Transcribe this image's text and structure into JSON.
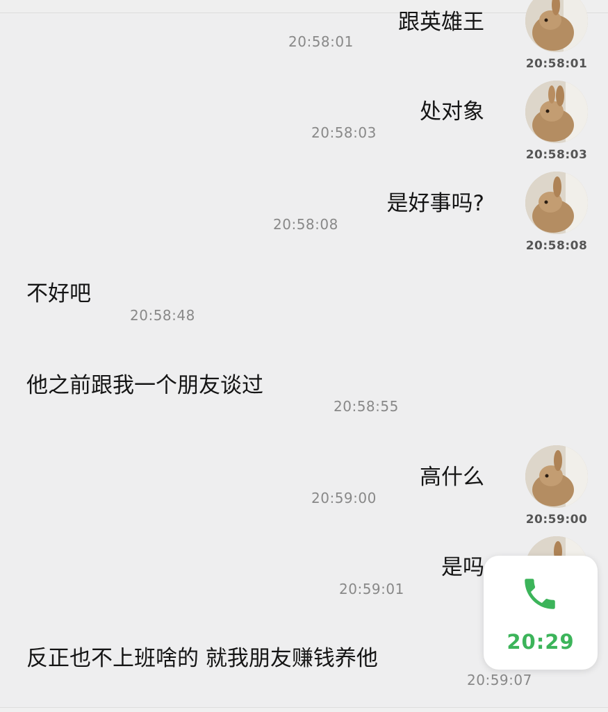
{
  "messages": [
    {
      "side": "right",
      "text": "跟英雄王",
      "time": "20:58:01",
      "avatar_time": "20:58:01"
    },
    {
      "side": "right",
      "text": "处对象",
      "time": "20:58:03",
      "avatar_time": "20:58:03"
    },
    {
      "side": "right",
      "text": "是好事吗?",
      "time": "20:58:08",
      "avatar_time": "20:58:08"
    },
    {
      "side": "left",
      "text": "不好吧",
      "time": "20:58:48"
    },
    {
      "side": "left",
      "text": "他之前跟我一个朋友谈过",
      "time": "20:58:55"
    },
    {
      "side": "right",
      "text": "高什么",
      "time": "20:59:00",
      "avatar_time": "20:59:00"
    },
    {
      "side": "right",
      "text": "是吗",
      "time": "20:59:01"
    },
    {
      "side": "left",
      "text": "反正也不上班啥的 就我朋友赚钱养他",
      "time": "20:59:07"
    }
  ],
  "call_overlay": {
    "icon": "phone-icon",
    "time": "20:29",
    "color": "#3cb45a"
  },
  "avatar": {
    "icon": "rabbit-avatar"
  }
}
